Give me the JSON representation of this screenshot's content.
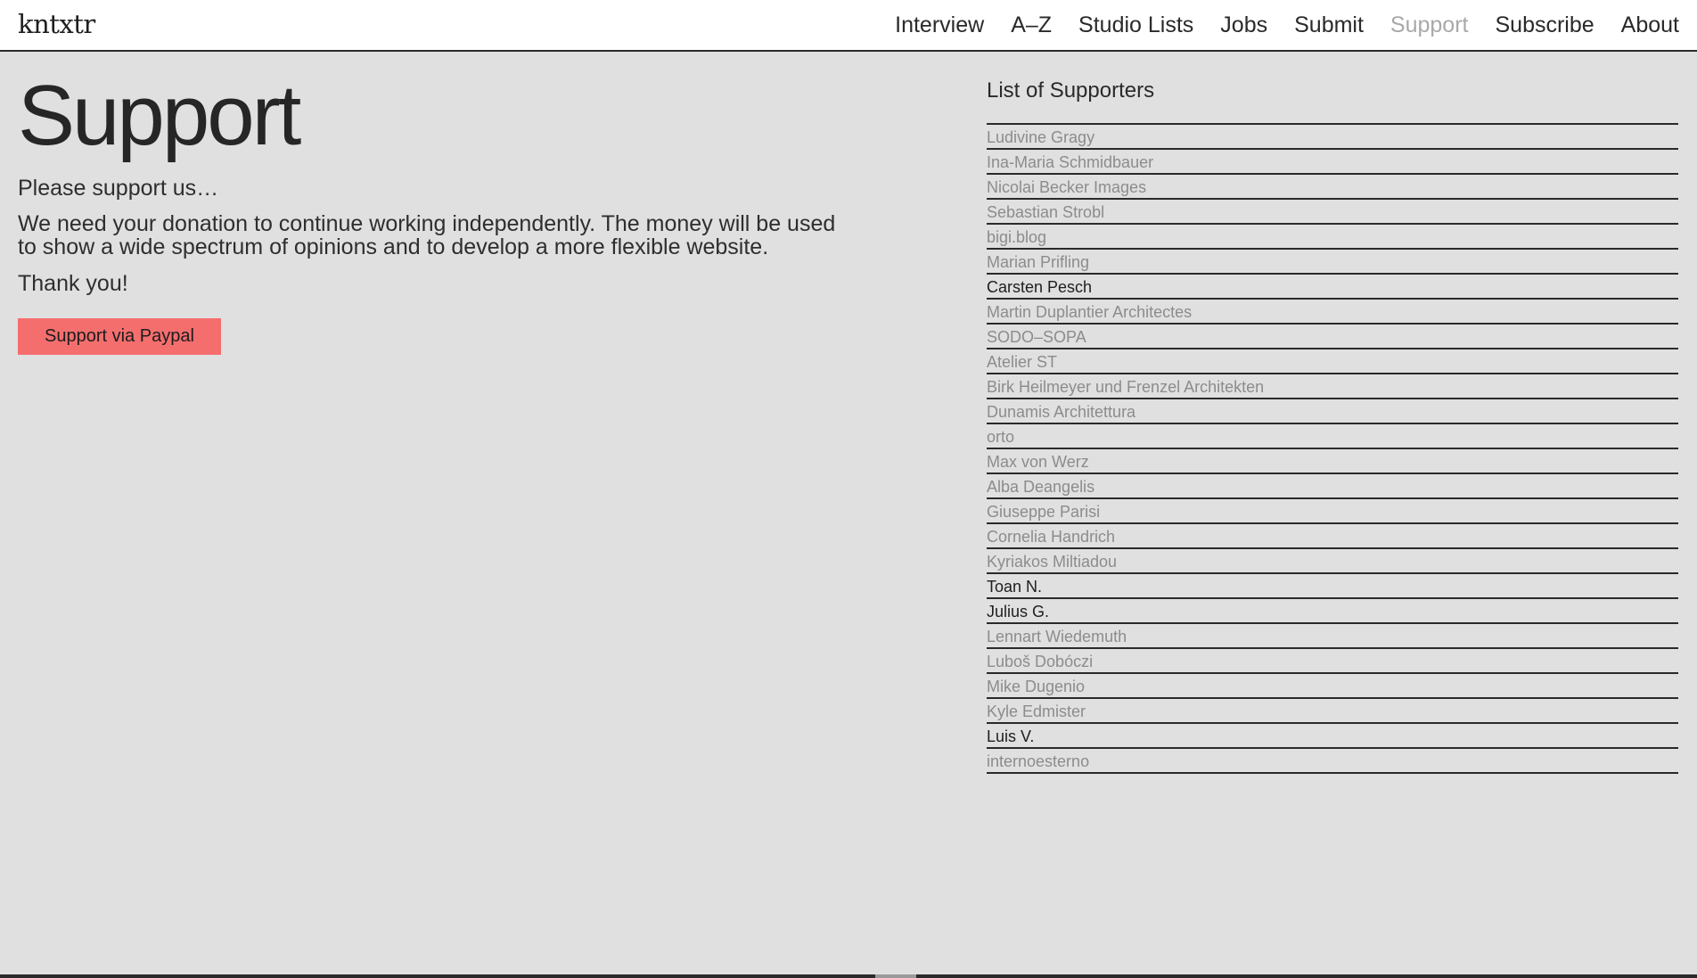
{
  "header": {
    "logo": "kntxtr",
    "nav": [
      {
        "label": "Interview"
      },
      {
        "label": "A–Z"
      },
      {
        "label": "Studio Lists"
      },
      {
        "label": "Jobs"
      },
      {
        "label": "Submit"
      },
      {
        "label": "Support",
        "active": true
      },
      {
        "label": "Subscribe"
      },
      {
        "label": "About"
      }
    ]
  },
  "main": {
    "title": "Support",
    "intro": "Please support us…",
    "body": "We need your donation to continue working independently. The money will be used to show a wide spectrum of opinions and to develop a more flexible website.",
    "thanks": "Thank you!",
    "paypal_label": "Support via Paypal"
  },
  "supporters": {
    "title": "List of Supporters",
    "items": [
      {
        "name": "Ludivine Gragy",
        "dark": false
      },
      {
        "name": "Ina-Maria Schmidbauer",
        "dark": false
      },
      {
        "name": "Nicolai Becker Images",
        "dark": false
      },
      {
        "name": "Sebastian Strobl",
        "dark": false
      },
      {
        "name": "bigi.blog",
        "dark": false
      },
      {
        "name": "Marian Prifling",
        "dark": false
      },
      {
        "name": "Carsten Pesch",
        "dark": true
      },
      {
        "name": "Martin Duplantier Architectes",
        "dark": false
      },
      {
        "name": "SODO–SOPA",
        "dark": false
      },
      {
        "name": "Atelier ST",
        "dark": false
      },
      {
        "name": "Birk Heilmeyer und Frenzel Architekten",
        "dark": false
      },
      {
        "name": "Dunamis Architettura",
        "dark": false
      },
      {
        "name": "orto",
        "dark": false
      },
      {
        "name": "Max von Werz",
        "dark": false
      },
      {
        "name": "Alba Deangelis",
        "dark": false
      },
      {
        "name": "Giuseppe Parisi",
        "dark": false
      },
      {
        "name": "Cornelia Handrich",
        "dark": false
      },
      {
        "name": "Kyriakos Miltiadou",
        "dark": false
      },
      {
        "name": "Toan N.",
        "dark": true
      },
      {
        "name": "Julius G.",
        "dark": true
      },
      {
        "name": "Lennart Wiedemuth",
        "dark": false
      },
      {
        "name": "Luboš Dobóczi",
        "dark": false
      },
      {
        "name": "Mike Dugenio",
        "dark": false
      },
      {
        "name": "Kyle Edmister",
        "dark": false
      },
      {
        "name": "Luis V.",
        "dark": true
      },
      {
        "name": "internoesterno",
        "dark": false
      }
    ]
  },
  "colors": {
    "background": "#e0e0e0",
    "header_bg": "#ffffff",
    "button": "#f46e6e",
    "muted_text": "#8c8c8c",
    "active_nav": "#a9a9a9"
  }
}
